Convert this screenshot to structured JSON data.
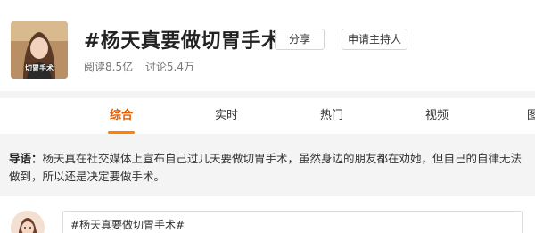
{
  "topic": {
    "title": "#杨天真要做切胃手术#",
    "cover_caption": "切胃手术",
    "share_label": "分享",
    "host_label": "申请主持人",
    "reads": "阅读8.5亿",
    "discussions": "讨论5.4万"
  },
  "tabs": [
    {
      "label": "综合",
      "active": true
    },
    {
      "label": "实时",
      "active": false
    },
    {
      "label": "热门",
      "active": false
    },
    {
      "label": "视频",
      "active": false
    },
    {
      "label": "图",
      "active": false
    }
  ],
  "guide": {
    "label": "导语：",
    "text": "杨天真在社交媒体上宣布自己过几天要做切胃手术，虽然身边的朋友都在劝她，但自己的自律无法做到，所以还是决定要做手术。"
  },
  "composer": {
    "value": "#杨天真要做切胃手术#"
  },
  "colors": {
    "accent": "#ff8200",
    "active_tab_text": "#e85d00",
    "page_background": "#f4f4f4"
  }
}
